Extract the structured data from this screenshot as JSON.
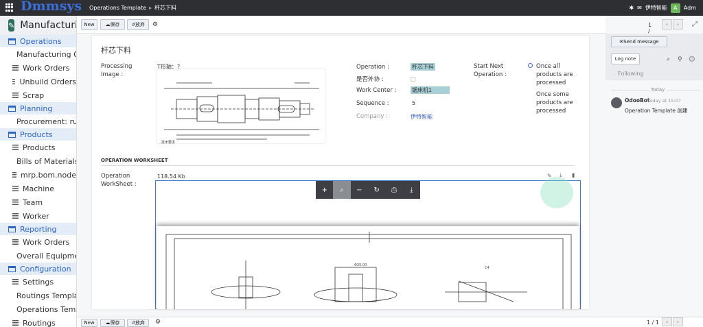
{
  "topbar": {
    "brand_main": "Dmm",
    "brand_accent": "sys",
    "breadcrumb_parent": "Operations Template",
    "breadcrumb_current": "杆芯下料",
    "company": "伊特智能",
    "user_initial": "A",
    "user_name": "Adm"
  },
  "sidebar": {
    "app_title": "Manufacturing",
    "sections": [
      {
        "label": "Operations",
        "items": [
          "Manufacturing Orders",
          "Work Orders",
          "Unbuild Orders",
          "Scrap"
        ]
      },
      {
        "label": "Planning",
        "items": [
          "Procurement: run"
        ]
      },
      {
        "label": "Products",
        "items": [
          "Products",
          "Bills of Materials",
          "mrp.bom.node",
          "Machine",
          "Team",
          "Worker"
        ]
      },
      {
        "label": "Reporting",
        "items": [
          "Work Orders",
          "Overall Equipment"
        ]
      },
      {
        "label": "Configuration",
        "items": [
          "Settings",
          "Routings Templates",
          "Operations Templates",
          "Routings"
        ]
      }
    ]
  },
  "toolbar": {
    "new": "New",
    "save": "保存",
    "discard": "放弃",
    "pager": "1 / 1"
  },
  "form": {
    "title": "杆芯下料",
    "processing_image_label": "Processing Image :",
    "drawing_caption": "T形轴：?",
    "operation_label": "Operation :",
    "operation_value": "杆芯下料",
    "outsource_label": "是否外协 :",
    "workcenter_label": "Work Center :",
    "workcenter_value": "锯床机1",
    "sequence_label": "Sequence :",
    "sequence_value": "5",
    "company_label": "Company :",
    "company_value": "伊特智能",
    "start_next_label": "Start Next Operation :",
    "opt1": "Once all products are processed",
    "opt2": "Once some products are processed",
    "worksheet_section": "OPERATION WORKSHEET",
    "worksheet_label": "Operation WorkSheet :",
    "file_size": "118.54 Kb"
  },
  "chatter": {
    "send": "Send message",
    "log": "Log note",
    "following": "Following",
    "today": "Today",
    "author": "OdooBot",
    "time": "today at 15:07",
    "msg": "Operation Template 创建"
  },
  "bottom": {
    "new": "New",
    "save": "保存",
    "discard": "放弃",
    "pager": "1 / 1"
  }
}
